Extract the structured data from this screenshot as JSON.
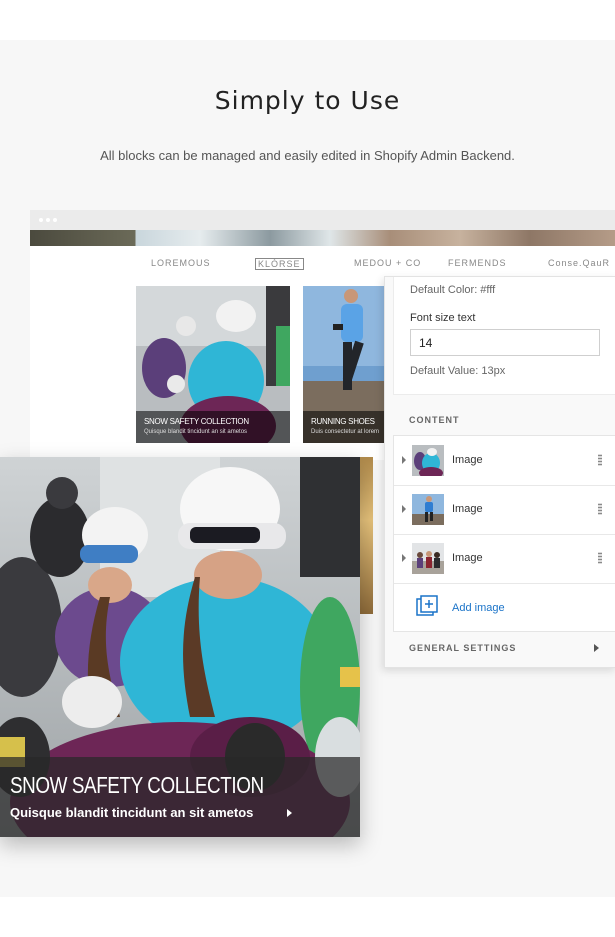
{
  "section": {
    "title": "Simply to Use",
    "subtitle": "All blocks can be managed and easily edited in Shopify Admin Backend."
  },
  "preview": {
    "brands": [
      "LOREMOUS",
      "KLÓRSE",
      "MEDOU + CO",
      "FERMENDS",
      "Conse.QauR"
    ],
    "cards": [
      {
        "title": "SNOW SAFETY COLLECTION",
        "subtitle": "Quisque blandit tincidunt an sit ametos"
      },
      {
        "title": "RUNNING SHOES",
        "subtitle": "Duis consectetur at lorem"
      }
    ]
  },
  "panel": {
    "default_color_text": "Default Color: #fff",
    "font_size_label": "Font size text",
    "font_size_value": "14",
    "default_value_text": "Default Value: 13px",
    "content_heading": "CONTENT",
    "items": [
      {
        "label": "Image",
        "icon": "snow-thumb"
      },
      {
        "label": "Image",
        "icon": "runner-thumb"
      },
      {
        "label": "Image",
        "icon": "group-thumb"
      }
    ],
    "add_image_label": "Add image",
    "general_settings_label": "GENERAL SETTINGS"
  },
  "featured": {
    "title": "SNOW SAFETY COLLECTION",
    "subtitle": "Quisque blandit tincidunt an sit ametos"
  },
  "colors": {
    "accent": "#1a73c8",
    "caption_bg": "#282828",
    "teal_jacket": "#2fb6d6",
    "purple_pants": "#6d2656"
  }
}
